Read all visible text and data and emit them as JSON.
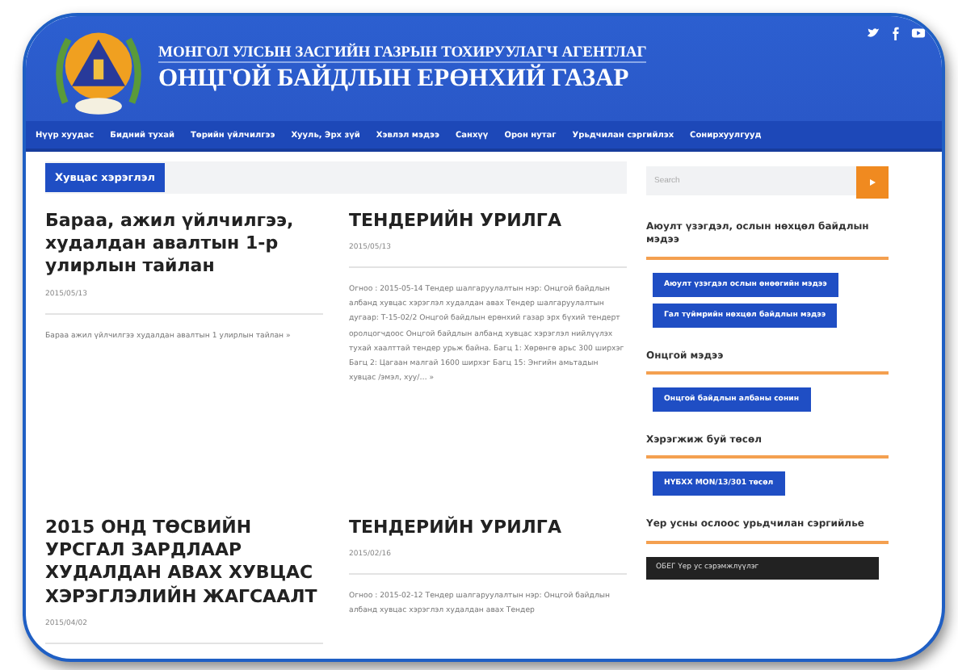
{
  "header": {
    "agency_line": "МОНГОЛ УЛСЫН ЗАСГИЙН ГАЗРЫН ТОХИРУУЛАГЧ АГЕНТЛАГ",
    "title": "ОНЦГОЙ БАЙДЛЫН ЕРӨНХИЙ ГАЗАР",
    "social": [
      {
        "kind": "twitter"
      },
      {
        "kind": "facebook"
      },
      {
        "kind": "youtube"
      }
    ]
  },
  "nav": [
    "Нүүр хуудас",
    "Бидний тухай",
    "Төрийн үйлчилгээ",
    "Хууль, Эрх зүй",
    "Хэвлэл мэдээ",
    "Санхүү",
    "Орон нутаг",
    "Урьдчилан сэргийлэх",
    "Сонирхуулгууд"
  ],
  "section_tab": "Хувцас хэрэглэл",
  "posts": [
    {
      "title": "Бараа, ажил үйлчилгээ, худалдан авалтын 1-р улирлын тайлан",
      "date": "2015/05/13",
      "excerpt": "Бараа ажил үйлчилгээ худалдан авалтын 1 улирлын тайлан »"
    },
    {
      "title": "ТЕНДЕРИЙН УРИЛГА",
      "date": "2015/05/13",
      "excerpt": "Огноо : 2015-05-14 Тендер шалгаруулалтын нэр: Онцгой байдлын албанд хувцас хэрэглэл худалдан авах Тендер шалгаруулалтын дугаар: Т-15-02/2 Онцгой байдлын ерөнхий газар эрх бүхий тендерт оролцогчдоос Онцгой байдлын албанд хувцас хэрэглэл нийлүүлэх тухай хаалттай тендер урьж байна. Багц 1: Хөрөнгө арьс 300 ширхэг Багц 2: Цагаан малгай 1600 ширхэг Багц 15: Энгийн амьтадын хувцас /эмэл, хуу/… »"
    },
    {
      "title": "2015 ОНД ТӨСВИЙН УРСГАЛ ЗАРДЛААР ХУДАЛДАН АВАХ ХУВЦАС ХЭРЭГЛЭЛИЙН ЖАГСААЛТ",
      "date": "2015/04/02"
    },
    {
      "title": "ТЕНДЕРИЙН УРИЛГА",
      "date": "2015/02/16",
      "excerpt": "Огноо : 2015-02-12 Тендер шалгаруулалтын нэр: Онцгой байдлын албанд хувцас хэрэглэл худалдан авах Тендер"
    }
  ],
  "search": {
    "placeholder": "Search"
  },
  "widgets": [
    {
      "title": "Аюулт үзэгдэл, ослын нөхцөл байдлын мэдээ",
      "buttons": [
        "Аюулт үзэгдэл ослын өнөөгийн мэдээ",
        "Гал түймрийн нөхцөл байдлын мэдээ"
      ]
    },
    {
      "title": "Онцгой мэдээ",
      "buttons": [
        "Онцгой байдлын албаны сонин"
      ]
    },
    {
      "title": "Хэрэгжиж буй төсөл",
      "buttons": [
        "НҮБХХ MON/13/301 төсөл"
      ]
    },
    {
      "title": "Үер усны ослоос урьдчилан сэргийлье",
      "video_title": "ОБЕГ Үер ус сэрэмжлүүлэг"
    }
  ]
}
